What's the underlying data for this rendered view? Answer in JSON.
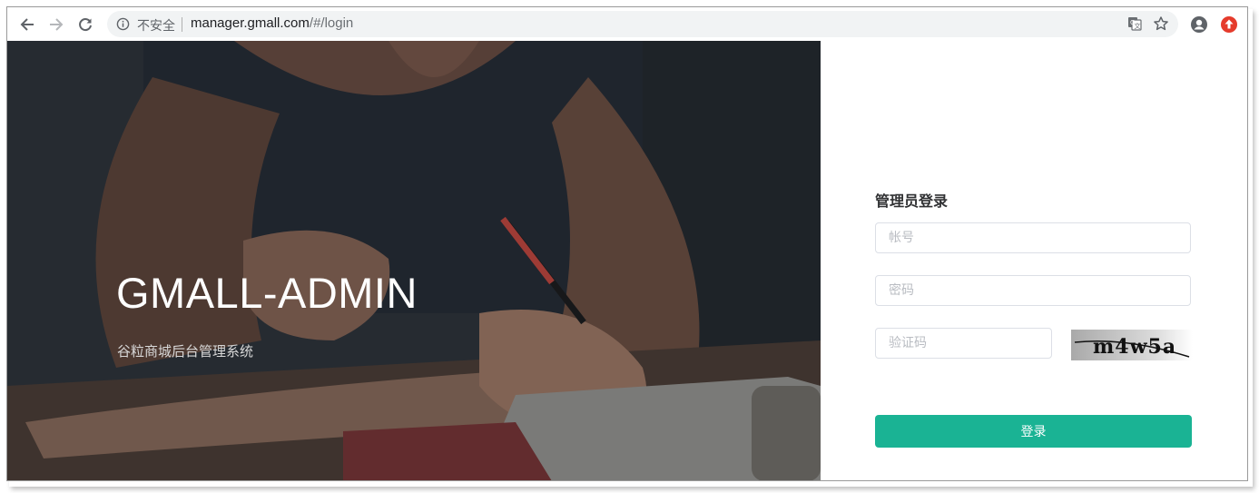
{
  "browser": {
    "security_label": "不安全",
    "url_host": "manager.gmall.com",
    "url_path": "/#/login"
  },
  "hero": {
    "title": "GMALL-ADMIN",
    "subtitle": "谷粒商城后台管理系统"
  },
  "login": {
    "title": "管理员登录",
    "username_placeholder": "帐号",
    "password_placeholder": "密码",
    "captcha_placeholder": "验证码",
    "captcha_text": "m4w5a",
    "submit_label": "登录"
  },
  "colors": {
    "accent": "#1ab394",
    "hero_overlay": "#2b3036"
  }
}
